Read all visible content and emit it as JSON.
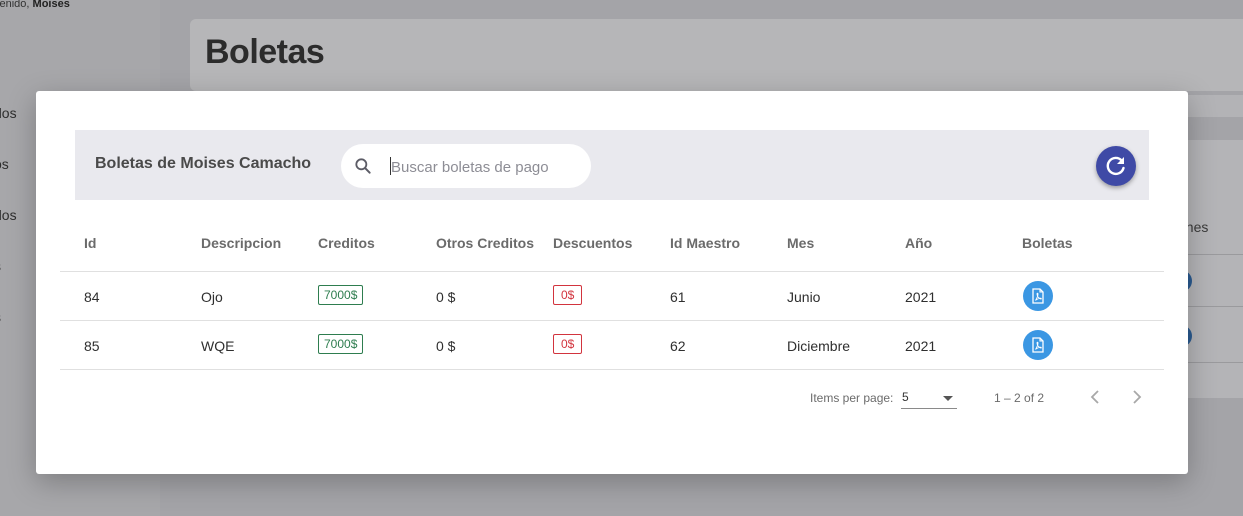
{
  "sidebar": {
    "welcome_prefix": "venido,",
    "welcome_name": "Moises",
    "items": [
      "dos",
      "os",
      "dos",
      "s",
      "s"
    ]
  },
  "page": {
    "title": "Boletas",
    "bg_column_fragment": "ones"
  },
  "modal": {
    "title": "Boletas de Moises Camacho",
    "search_placeholder": "Buscar boletas de pago",
    "columns": [
      "Id",
      "Descripcion",
      "Creditos",
      "Otros Creditos",
      "Descuentos",
      "Id Maestro",
      "Mes",
      "Año",
      "Boletas"
    ],
    "rows": [
      {
        "id": "84",
        "descripcion": "Ojo",
        "creditos": "7000$",
        "otros_creditos": "0 $",
        "descuentos": "0$",
        "id_maestro": "61",
        "mes": "Junio",
        "anio": "2021"
      },
      {
        "id": "85",
        "descripcion": "WQE",
        "creditos": "7000$",
        "otros_creditos": "0 $",
        "descuentos": "0$",
        "id_maestro": "62",
        "mes": "Diciembre",
        "anio": "2021"
      }
    ],
    "paginator": {
      "items_per_page_label": "Items per page:",
      "items_per_page_value": "5",
      "range_label": "1 – 2 of 2"
    }
  },
  "colors": {
    "primary_button": "#3f4aa6",
    "pdf_button": "#3b97e3",
    "credit_badge": "#2e7d4f",
    "discount_badge": "#d2343e"
  },
  "icons": [
    "search-icon",
    "refresh-icon",
    "pdf-file-icon",
    "chevron-left-icon",
    "chevron-right-icon",
    "chevron-down-icon"
  ]
}
